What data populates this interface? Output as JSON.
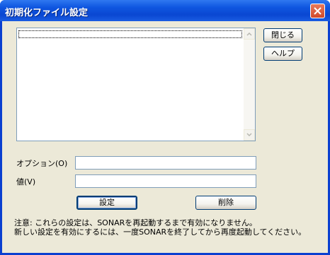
{
  "window": {
    "title": "初期化ファイル設定"
  },
  "buttons": {
    "close": "閉じる",
    "help": "ヘルプ",
    "set": "設定",
    "delete": "削除"
  },
  "fields": {
    "option_label": "オプション(O)",
    "option_value": "",
    "value_label": "値(V)",
    "value_value": ""
  },
  "notes": [
    "注意: これらの設定は、SONARを再起動するまで有効になりません。",
    "新しい設定を有効にするには、一度SONARを終了してから再度起動してください。"
  ],
  "icons": {
    "title_close": "close-icon",
    "scroll_up": "chevron-up-icon",
    "scroll_down": "chevron-down-icon"
  },
  "colors": {
    "titlebar": "#0a47d2",
    "dialog_face": "#ece9d8",
    "close_button": "#d0492b",
    "button_border": "#003c74"
  }
}
